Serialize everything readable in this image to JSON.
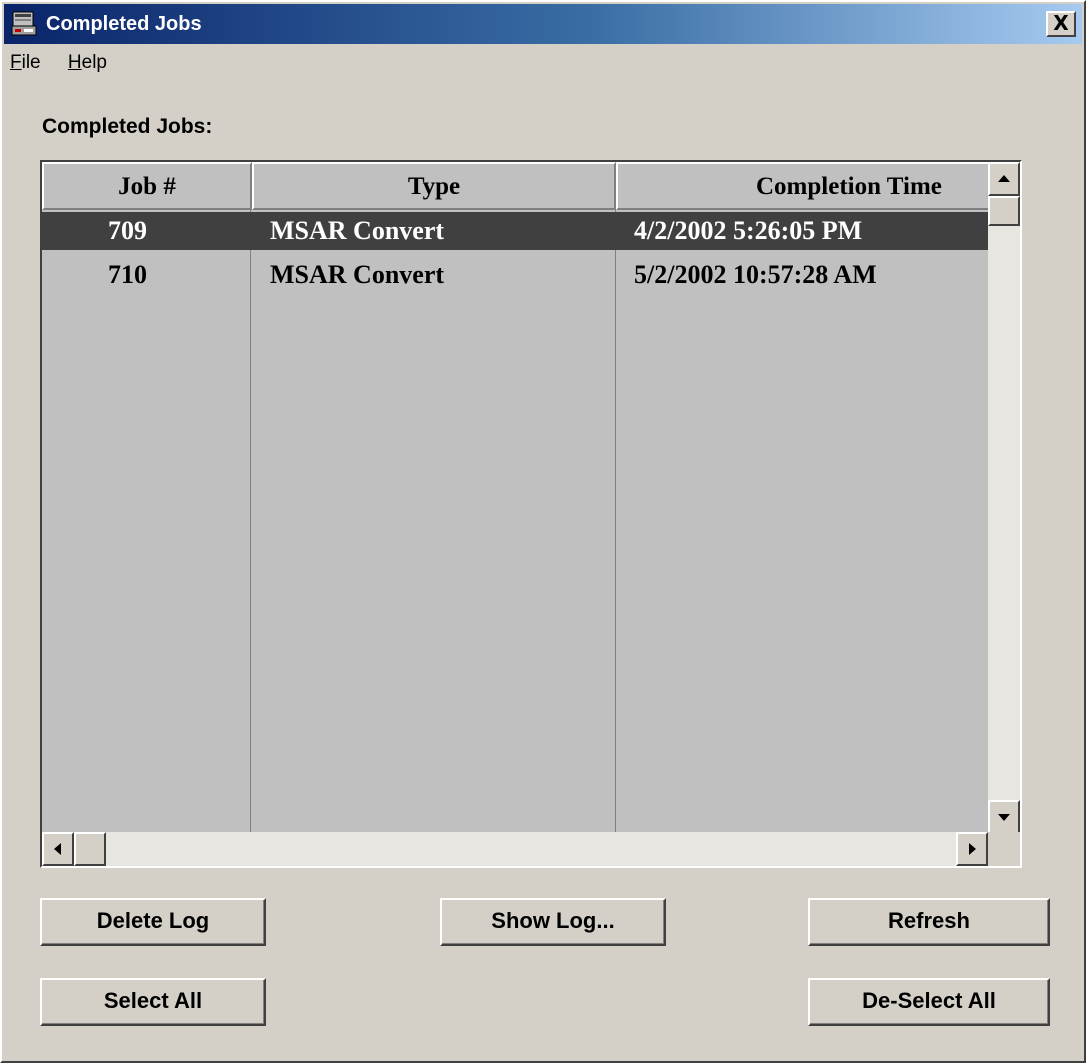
{
  "window": {
    "title": "Completed Jobs",
    "close_label": "X"
  },
  "menu": [
    {
      "accel": "F",
      "rest": "ile"
    },
    {
      "accel": "H",
      "rest": "elp"
    }
  ],
  "section_label": "Completed Jobs:",
  "table": {
    "columns": [
      "Job #",
      "Type",
      "Completion Time"
    ],
    "rows": [
      {
        "job": "709",
        "type": "MSAR Convert",
        "time": "4/2/2002 5:26:05 PM",
        "selected": true
      },
      {
        "job": "710",
        "type": "MSAR Convert",
        "time": "5/2/2002 10:57:28 AM",
        "selected": false
      }
    ]
  },
  "buttons": {
    "delete_log": "Delete Log",
    "show_log": "Show Log...",
    "refresh": "Refresh",
    "select_all": "Select All",
    "deselect_all": "De-Select All"
  },
  "icons": {
    "app": "app-window-icon",
    "close": "close-icon",
    "scroll_up": "arrow-up-icon",
    "scroll_down": "arrow-down-icon",
    "scroll_left": "arrow-left-icon",
    "scroll_right": "arrow-right-icon"
  },
  "colors": {
    "titlebar_start": "#0a246a",
    "titlebar_end": "#a6caf0",
    "selection": "#404040",
    "face": "#d4d0c8"
  }
}
